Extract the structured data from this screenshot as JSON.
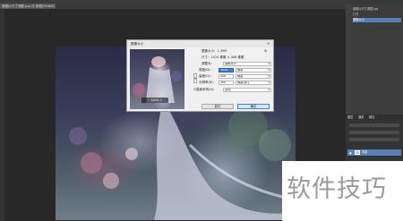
{
  "document_tab": "原图片尺寸调整.jpg @ 原图(RGB/8)",
  "history_panel": {
    "items": [
      {
        "label": "原图片尺寸调整.jpg",
        "active": false
      },
      {
        "label": "打开",
        "active": false
      },
      {
        "label": "图像大小",
        "active": true
      }
    ]
  },
  "layers_panel": {
    "tabs": [
      "图层",
      "通道",
      "路径"
    ],
    "layer_name": "背景"
  },
  "dialog": {
    "title": "图像大小",
    "close_symbol": "×",
    "image_size_label": "图像大小：",
    "image_size_value": "1.39M",
    "dimensions_label": "尺寸：",
    "dimensions_value": "1024 像素 × 406 像素",
    "fit_label": "调整为：",
    "fit_value": "原稿大小",
    "width_label": "宽度(D)：",
    "width_value": "1024",
    "width_unit": "像素",
    "height_label": "高度(G)：",
    "height_value": "406",
    "height_unit": "像素",
    "resolution_label": "分辨率(R)：",
    "resolution_value": "300",
    "resolution_unit": "像素/英寸",
    "resample_label": "重新采样(S)：",
    "resample_value": "自动",
    "zoom_value": "100%",
    "reset_button": "复位",
    "ok_button": "确定"
  },
  "watermark": "软件技巧",
  "colors": {
    "dialog_bg": "#f0f0f0",
    "selection_blue": "#3d7bd6",
    "panel_dark": "#383838",
    "history_active": "#5b7db5"
  }
}
